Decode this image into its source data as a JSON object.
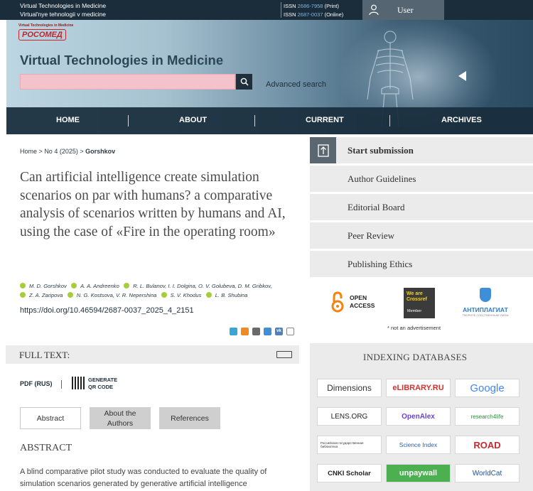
{
  "topbar": {
    "journal_en": "Virtual Technologies in Medicine",
    "journal_translit": "Virtual'nye tehnologii v medicine",
    "issn_print_prefix": "ISSN",
    "issn_print_number": "2686-7958",
    "issn_print_suffix": "(Print)",
    "issn_online_prefix": "ISSN",
    "issn_online_number": "2687-0037",
    "issn_online_suffix": "(Online)",
    "user_label": "User",
    "user_icon": "user-icon"
  },
  "header": {
    "logo_small": "Virtual Technologies in Medicine",
    "logo_main": "РОСОМЕД",
    "title": "Virtual Technologies in Medicine",
    "search_value": "",
    "search_icon": "search-icon",
    "advanced_search": "Advanced search"
  },
  "nav": {
    "items": [
      "HOME",
      "ABOUT",
      "CURRENT",
      "ARCHIVES"
    ]
  },
  "breadcrumb": {
    "home": "Home",
    "sep": ">",
    "issue": "No 4 (2025)",
    "current": "Gorshkov"
  },
  "article": {
    "title": "Can artificial intelligence create simulation scenarios on par with humans? a comparative analysis of scenarios written by humans and AI, using the case of «Fire in the operating room»",
    "authors": [
      "M. D. Gorshkov",
      "A. A. Andreenko",
      "R. L. Bulanov, I. I. Dolgina, O. V. Golubeva, D. M. Gribkov,",
      "Z. A. Zaripova",
      "N. G. Kostsova, V. R. Nepershina",
      "S. V. Khodus",
      "L. B. Shubina"
    ],
    "doi": "https://doi.org/10.46594/2687-0037_2025_4_2151",
    "share_icons": [
      "vk-share-icon",
      "telegram-share-icon",
      "ok-share-icon",
      "email-share-icon",
      "viber-share-icon",
      "copy-share-icon"
    ]
  },
  "fulltext": {
    "label": "FULL TEXT:",
    "pdf": "PDF (RUS)",
    "qr_line1": "GENERATE",
    "qr_line2": "QR CODE"
  },
  "tabs": [
    "Abstract",
    "About the Authors",
    "References"
  ],
  "abstract": {
    "heading": "ABSTRACT",
    "text": "A blind comparative pilot study was conducted to evaluate the quality of simulation scenarios generated by generative artificial intelligence"
  },
  "sidebar": {
    "items": [
      "Start submission",
      "Author Guidelines",
      "Editorial Board",
      "Peer Review",
      "Publishing Ethics"
    ],
    "open_access_l1": "OPEN",
    "open_access_l2": "ACCESS",
    "crossref_l1": "We are",
    "crossref_l2": "Crossref",
    "crossref_l3": "Member",
    "antiplagiat": "АНТИПЛАГИАТ",
    "antiplagiat_sub": "ТВОРИТЕ СОБСТВЕННЫМ УМОМ",
    "not_ad": "* not an advertisement",
    "indexing_title": "INDEXING DATABASES",
    "databases": [
      "Dimensions",
      "eLIBRARY.RU",
      "Google",
      "LENS.ORG",
      "OpenAlex",
      "research4life",
      "Российская государственная библиотека",
      "Science Index",
      "ROAD",
      "CNKI Scholar",
      "unpaywall",
      "WorldCat"
    ]
  },
  "colors": {
    "topbar": "#1b2d3b",
    "nav": "#192d3c",
    "search_field": "#f4c2ca",
    "sidebar_bg": "#ebebeb",
    "open_access": "#f68212",
    "google_blue": "#4285f4"
  }
}
